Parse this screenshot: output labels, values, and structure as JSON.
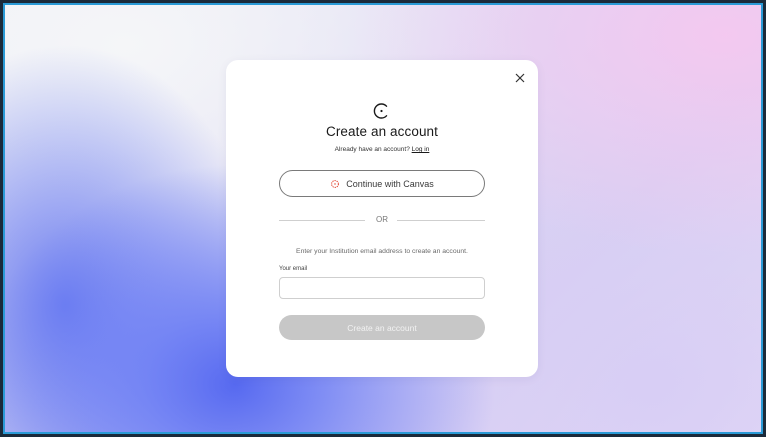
{
  "modal": {
    "title": "Create an account",
    "subtitle_prefix": "Already have an account?",
    "login_link": "Log in",
    "sso_button_label": "Continue with Canvas",
    "divider_text": "OR",
    "instruction": "Enter your Institution email address to create an account.",
    "email_label": "Your email",
    "email_value": "",
    "email_placeholder": "",
    "submit_label": "Create an account"
  },
  "icons": {
    "close": "close-icon",
    "logo": "brand-logo-icon",
    "canvas": "canvas-icon"
  },
  "colors": {
    "canvas_brand": "#e13f2b",
    "disabled_button": "#c7c7c7",
    "frame_border": "#2a9ad6"
  }
}
